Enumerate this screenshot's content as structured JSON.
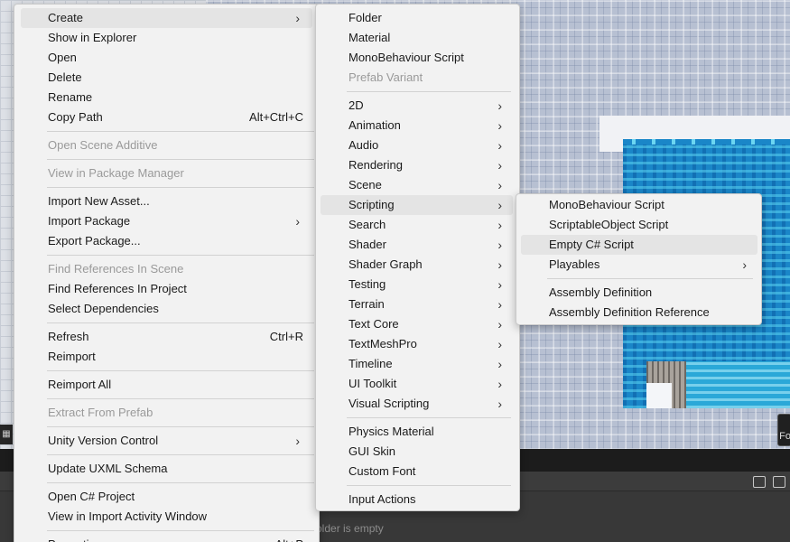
{
  "context_menu": {
    "items": [
      {
        "label": "Create",
        "submenu": true,
        "highlighted": true
      },
      {
        "label": "Show in Explorer"
      },
      {
        "label": "Open"
      },
      {
        "label": "Delete"
      },
      {
        "label": "Rename"
      },
      {
        "label": "Copy Path",
        "shortcut": "Alt+Ctrl+C"
      },
      {
        "label": "Open Scene Additive",
        "disabled": true
      },
      {
        "label": "View in Package Manager",
        "disabled": true
      },
      {
        "label": "Import New Asset..."
      },
      {
        "label": "Import Package",
        "submenu": true
      },
      {
        "label": "Export Package..."
      },
      {
        "label": "Find References In Scene",
        "disabled": true
      },
      {
        "label": "Find References In Project"
      },
      {
        "label": "Select Dependencies"
      },
      {
        "label": "Refresh",
        "shortcut": "Ctrl+R"
      },
      {
        "label": "Reimport"
      },
      {
        "label": "Reimport All"
      },
      {
        "label": "Extract From Prefab",
        "disabled": true
      },
      {
        "label": "Unity Version Control",
        "submenu": true
      },
      {
        "label": "Update UXML Schema"
      },
      {
        "label": "Open C# Project"
      },
      {
        "label": "View in Import Activity Window"
      },
      {
        "label": "Properties...",
        "shortcut": "Alt+P"
      }
    ]
  },
  "create_menu": {
    "items": [
      {
        "label": "Folder"
      },
      {
        "label": "Material"
      },
      {
        "label": "MonoBehaviour Script"
      },
      {
        "label": "Prefab Variant",
        "disabled": true
      },
      {
        "label": "2D",
        "submenu": true
      },
      {
        "label": "Animation",
        "submenu": true
      },
      {
        "label": "Audio",
        "submenu": true
      },
      {
        "label": "Rendering",
        "submenu": true
      },
      {
        "label": "Scene",
        "submenu": true
      },
      {
        "label": "Scripting",
        "submenu": true,
        "highlighted": true
      },
      {
        "label": "Search",
        "submenu": true
      },
      {
        "label": "Shader",
        "submenu": true
      },
      {
        "label": "Shader Graph",
        "submenu": true
      },
      {
        "label": "Testing",
        "submenu": true
      },
      {
        "label": "Terrain",
        "submenu": true
      },
      {
        "label": "Text Core",
        "submenu": true
      },
      {
        "label": "TextMeshPro",
        "submenu": true
      },
      {
        "label": "Timeline",
        "submenu": true
      },
      {
        "label": "UI Toolkit",
        "submenu": true
      },
      {
        "label": "Visual Scripting",
        "submenu": true
      },
      {
        "label": "Physics Material"
      },
      {
        "label": "GUI Skin"
      },
      {
        "label": "Custom Font"
      },
      {
        "label": "Input Actions"
      }
    ]
  },
  "scripting_menu": {
    "items": [
      {
        "label": "MonoBehaviour Script"
      },
      {
        "label": "ScriptableObject Script"
      },
      {
        "label": "Empty C# Script",
        "highlighted": true
      },
      {
        "label": "Playables",
        "submenu": true
      },
      {
        "label": "Assembly Definition"
      },
      {
        "label": "Assembly Definition Reference"
      }
    ]
  },
  "arrow_glyph": "›",
  "project_panel": {
    "empty_message": "older is empty"
  },
  "side_label": "Fo",
  "colors": {
    "menu_bg": "#f2f2f2",
    "highlight": "#e4e4e4",
    "water": "#1a86c8"
  }
}
